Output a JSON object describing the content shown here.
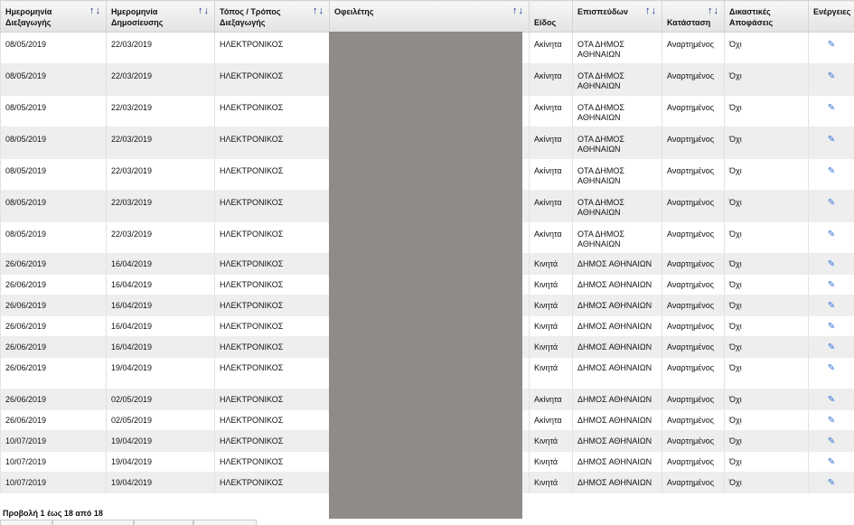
{
  "headers": {
    "auction_date": "Ημερομηνία Διεξαγωγής",
    "publish_date": "Ημερομηνία Δημοσίευσης",
    "place": "Τόπος / Τρόπος Διεξαγωγής",
    "debtor": "Οφειλέτης",
    "type": "Είδος",
    "creditor": "Επισπεύδων",
    "status": "Κατάσταση",
    "decisions": "Δικαστικές Αποφάσεις",
    "actions": "Ενέργειες"
  },
  "sort_glyph": "↑↓",
  "rows": [
    {
      "auction_date": "08/05/2019",
      "publish_date": "22/03/2019",
      "place": "ΗΛΕΚΤΡΟΝΙΚΟΣ",
      "type": "Ακίνητα",
      "creditor": "ΟΤΑ ΔΗΜΟΣ ΑΘΗΝΑΙΩΝ",
      "status": "Αναρτημένος",
      "decisions": "Όχι"
    },
    {
      "auction_date": "08/05/2019",
      "publish_date": "22/03/2019",
      "place": "ΗΛΕΚΤΡΟΝΙΚΟΣ",
      "type": "Ακίνητα",
      "creditor": "ΟΤΑ ΔΗΜΟΣ ΑΘΗΝΑΙΩΝ",
      "status": "Αναρτημένος",
      "decisions": "Όχι"
    },
    {
      "auction_date": "08/05/2019",
      "publish_date": "22/03/2019",
      "place": "ΗΛΕΚΤΡΟΝΙΚΟΣ",
      "type": "Ακίνητα",
      "creditor": "ΟΤΑ ΔΗΜΟΣ ΑΘΗΝΑΙΩΝ",
      "status": "Αναρτημένος",
      "decisions": "Όχι"
    },
    {
      "auction_date": "08/05/2019",
      "publish_date": "22/03/2019",
      "place": "ΗΛΕΚΤΡΟΝΙΚΟΣ",
      "type": "Ακίνητα",
      "creditor": "ΟΤΑ ΔΗΜΟΣ ΑΘΗΝΑΙΩΝ",
      "status": "Αναρτημένος",
      "decisions": "Όχι"
    },
    {
      "auction_date": "08/05/2019",
      "publish_date": "22/03/2019",
      "place": "ΗΛΕΚΤΡΟΝΙΚΟΣ",
      "type": "Ακίνητα",
      "creditor": "ΟΤΑ ΔΗΜΟΣ ΑΘΗΝΑΙΩΝ",
      "status": "Αναρτημένος",
      "decisions": "Όχι"
    },
    {
      "auction_date": "08/05/2019",
      "publish_date": "22/03/2019",
      "place": "ΗΛΕΚΤΡΟΝΙΚΟΣ",
      "type": "Ακίνητα",
      "creditor": "ΟΤΑ ΔΗΜΟΣ ΑΘΗΝΑΙΩΝ",
      "status": "Αναρτημένος",
      "decisions": "Όχι"
    },
    {
      "auction_date": "08/05/2019",
      "publish_date": "22/03/2019",
      "place": "ΗΛΕΚΤΡΟΝΙΚΟΣ",
      "type": "Ακίνητα",
      "creditor": "ΟΤΑ ΔΗΜΟΣ ΑΘΗΝΑΙΩΝ",
      "status": "Αναρτημένος",
      "decisions": "Όχι"
    },
    {
      "auction_date": "26/06/2019",
      "publish_date": "16/04/2019",
      "place": "ΗΛΕΚΤΡΟΝΙΚΟΣ",
      "type": "Κινητά",
      "creditor": "ΔΗΜΟΣ ΑΘΗΝΑΙΩΝ",
      "status": "Αναρτημένος",
      "decisions": "Όχι"
    },
    {
      "auction_date": "26/06/2019",
      "publish_date": "16/04/2019",
      "place": "ΗΛΕΚΤΡΟΝΙΚΟΣ",
      "type": "Κινητά",
      "creditor": "ΔΗΜΟΣ ΑΘΗΝΑΙΩΝ",
      "status": "Αναρτημένος",
      "decisions": "Όχι"
    },
    {
      "auction_date": "26/06/2019",
      "publish_date": "16/04/2019",
      "place": "ΗΛΕΚΤΡΟΝΙΚΟΣ",
      "type": "Κινητά",
      "creditor": "ΔΗΜΟΣ ΑΘΗΝΑΙΩΝ",
      "status": "Αναρτημένος",
      "decisions": "Όχι"
    },
    {
      "auction_date": "26/06/2019",
      "publish_date": "16/04/2019",
      "place": "ΗΛΕΚΤΡΟΝΙΚΟΣ",
      "type": "Κινητά",
      "creditor": "ΔΗΜΟΣ ΑΘΗΝΑΙΩΝ",
      "status": "Αναρτημένος",
      "decisions": "Όχι"
    },
    {
      "auction_date": "26/06/2019",
      "publish_date": "16/04/2019",
      "place": "ΗΛΕΚΤΡΟΝΙΚΟΣ",
      "type": "Κινητά",
      "creditor": "ΔΗΜΟΣ ΑΘΗΝΑΙΩΝ",
      "status": "Αναρτημένος",
      "decisions": "Όχι"
    },
    {
      "auction_date": "26/06/2019",
      "publish_date": "19/04/2019",
      "place": "ΗΛΕΚΤΡΟΝΙΚΟΣ",
      "type": "Κινητά",
      "creditor": "ΔΗΜΟΣ ΑΘΗΝΑΙΩΝ",
      "status": "Αναρτημένος",
      "decisions": "Όχι"
    },
    {
      "auction_date": "26/06/2019",
      "publish_date": "02/05/2019",
      "place": "ΗΛΕΚΤΡΟΝΙΚΟΣ",
      "type": "Ακίνητα",
      "creditor": "ΔΗΜΟΣ ΑΘΗΝΑΙΩΝ",
      "status": "Αναρτημένος",
      "decisions": "Όχι"
    },
    {
      "auction_date": "26/06/2019",
      "publish_date": "02/05/2019",
      "place": "ΗΛΕΚΤΡΟΝΙΚΟΣ",
      "type": "Ακίνητα",
      "creditor": "ΔΗΜΟΣ ΑΘΗΝΑΙΩΝ",
      "status": "Αναρτημένος",
      "decisions": "Όχι"
    },
    {
      "auction_date": "10/07/2019",
      "publish_date": "19/04/2019",
      "place": "ΗΛΕΚΤΡΟΝΙΚΟΣ",
      "type": "Κινητά",
      "creditor": "ΔΗΜΟΣ ΑΘΗΝΑΙΩΝ",
      "status": "Αναρτημένος",
      "decisions": "Όχι"
    },
    {
      "auction_date": "10/07/2019",
      "publish_date": "19/04/2019",
      "place": "ΗΛΕΚΤΡΟΝΙΚΟΣ",
      "type": "Κινητά",
      "creditor": "ΔΗΜΟΣ ΑΘΗΝΑΙΩΝ",
      "status": "Αναρτημένος",
      "decisions": "Όχι"
    },
    {
      "auction_date": "10/07/2019",
      "publish_date": "19/04/2019",
      "place": "ΗΛΕΚΤΡΟΝΙΚΟΣ",
      "type": "Κινητά",
      "creditor": "ΔΗΜΟΣ ΑΘΗΝΑΙΩΝ",
      "status": "Αναρτημένος",
      "decisions": "Όχι"
    }
  ],
  "edit_icon": "edit-icon",
  "footer": {
    "info": "Προβολή 1 έως 18 από 18"
  }
}
